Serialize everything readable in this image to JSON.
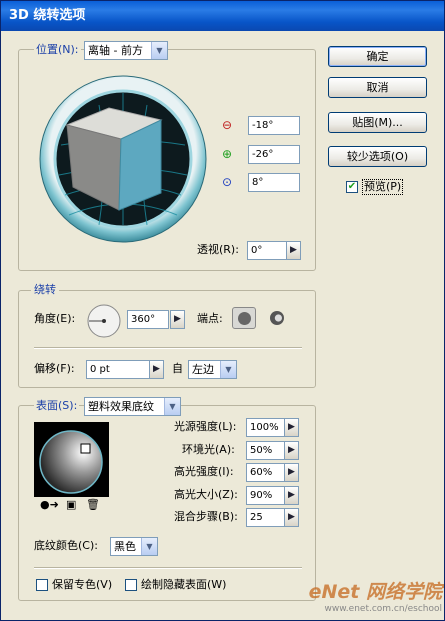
{
  "window": {
    "title": "3D 绕转选项"
  },
  "position": {
    "label": "位置(N):",
    "value": "离轴 - 前方",
    "x_angle": "-18°",
    "y_angle": "-26°",
    "z_angle": "8°",
    "perspective_label": "透视(R):",
    "perspective_value": "0°"
  },
  "revolve": {
    "group_label": "绕转",
    "angle_label": "角度(E):",
    "angle_value": "360°",
    "cap_label": "端点:",
    "offset_label": "偏移(F):",
    "offset_value": "0 pt",
    "from_label": "自",
    "from_value": "左边"
  },
  "surface": {
    "label": "表面(S):",
    "value": "塑料效果底纹",
    "light_intensity_label": "光源强度(L):",
    "light_intensity": "100%",
    "ambient_label": "环境光(A):",
    "ambient": "50%",
    "highlight_intensity_label": "高光强度(I):",
    "highlight_intensity": "60%",
    "highlight_size_label": "高光大小(Z):",
    "highlight_size": "90%",
    "blend_steps_label": "混合步骤(B):",
    "blend_steps": "25",
    "shading_color_label": "底纹颜色(C):",
    "shading_color": "黑色",
    "preserve_spot_label": "保留专色(V)",
    "draw_hidden_label": "绘制隐藏表面(W)"
  },
  "buttons": {
    "ok": "确定",
    "cancel": "取消",
    "map": "贴图(M)...",
    "fewer": "较少选项(O)",
    "preview": "预览(P)"
  },
  "watermark": {
    "text": "eNet 网络学院",
    "url": "www.enet.com.cn/eschool"
  },
  "colors": {
    "cube_front": "#5da8c0",
    "cube_top": "#ddddd8",
    "cube_side": "#8a8a88",
    "title_bar": "#0a5fd8"
  }
}
